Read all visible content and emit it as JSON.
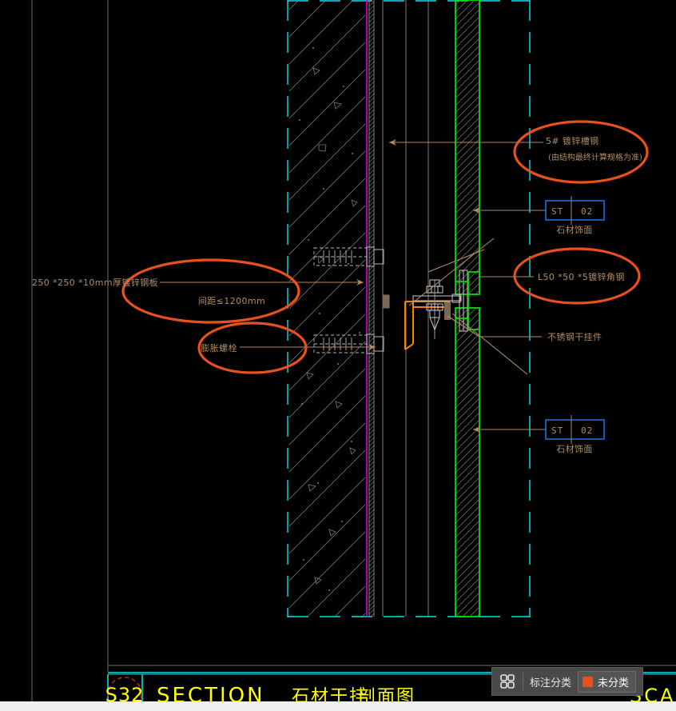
{
  "app": {
    "background_color": "#000000",
    "canvas_color": "#000000"
  },
  "annotations": [
    {
      "id": "channel-steel",
      "line1": "5# 镀锌槽钢",
      "line2": "(由结构最终计算规格为准)",
      "highlight": "ellipse",
      "highlight_color": "#e8501e"
    },
    {
      "id": "steel-plate",
      "line1": "250 *250 *10mm厚镀锌钢板",
      "line2": "间距≤1200mm",
      "highlight": "ellipse",
      "highlight_color": "#e8501e"
    },
    {
      "id": "expansion-bolt",
      "line1": "膨胀螺栓",
      "line2": "",
      "highlight": "ellipse",
      "highlight_color": "#e8501e"
    },
    {
      "id": "angle-steel",
      "line1": "L50 *50 *5镀锌角钢",
      "line2": "",
      "highlight": "ellipse",
      "highlight_color": "#e8501e"
    },
    {
      "id": "stainless-hanger",
      "line1": "不锈钢干挂件",
      "line2": "",
      "highlight": "none",
      "highlight_color": ""
    }
  ],
  "material_tags": [
    {
      "id": "stone-finish-upper",
      "code": "ST",
      "number": "02",
      "caption": "石材饰面",
      "box_color": "#1a6fe0"
    },
    {
      "id": "stone-finish-lower",
      "code": "ST",
      "number": "02",
      "caption": "石材饰面",
      "box_color": "#1a6fe0"
    }
  ],
  "title_block": {
    "sheet_number": "S32",
    "title_en": "SECTION",
    "title_cn_main": "石材干挂",
    "title_cn_sub": "剖面图",
    "scale_label": "SCALE",
    "text_color": "#ffff00",
    "border_color": "#00e5e5",
    "circle_color": "#c02020"
  },
  "toolbar": {
    "grid_icon": "grid-icon",
    "category_label": "标注分类",
    "chip_swatch_color": "#e8501e",
    "chip_label": "未分类"
  },
  "drawing_colors": {
    "boundary_dashed": "#00e5e5",
    "wall_hatch": "#8a8a8a",
    "stone_panel": "#00e000",
    "waterproof_line": "#e000e0",
    "angle_steel": "#ff8000",
    "hardware": "#b9b9b9",
    "leader": "#b08d64",
    "highlight": "#e8501e"
  }
}
